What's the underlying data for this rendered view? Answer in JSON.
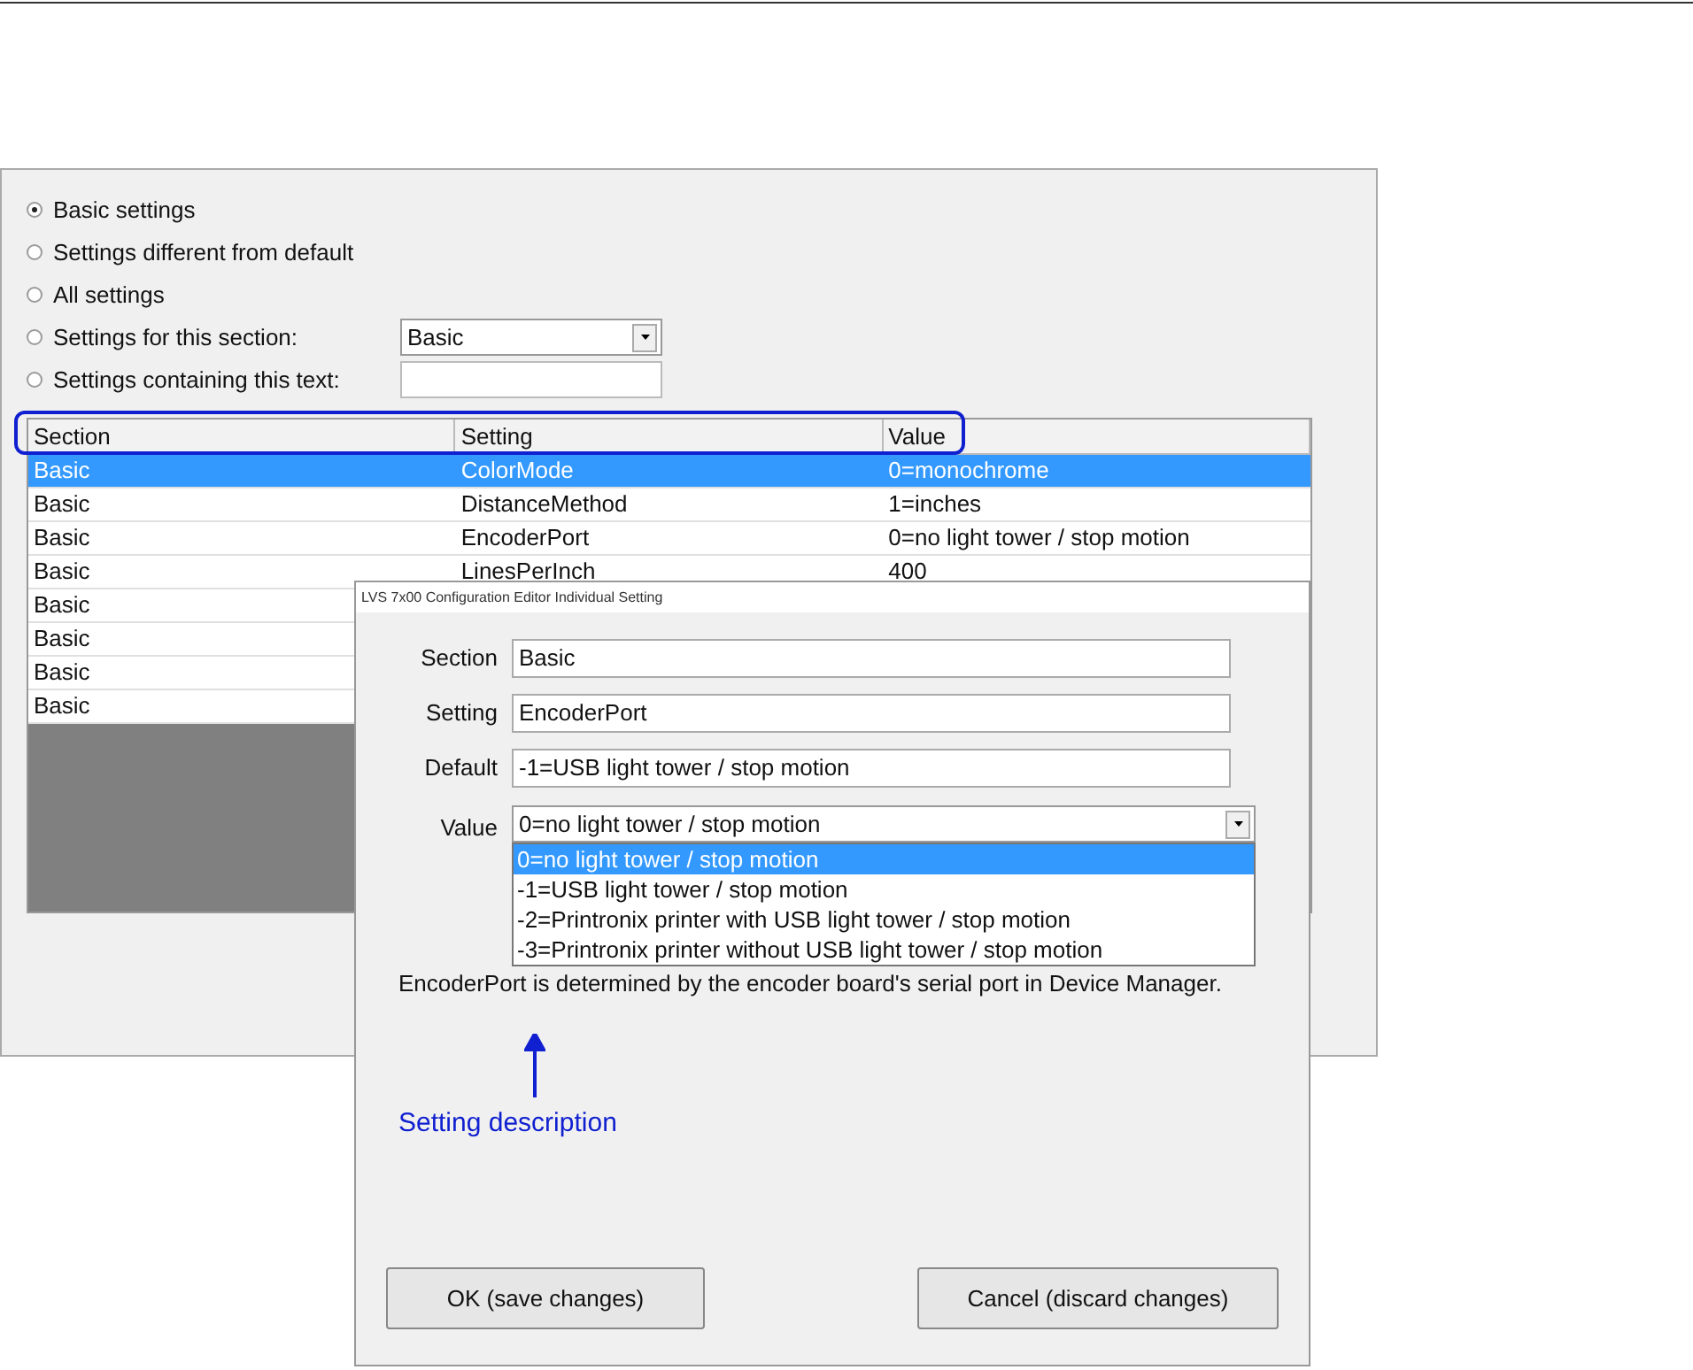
{
  "filter_options": [
    {
      "label": "Basic settings",
      "selected": true
    },
    {
      "label": "Settings different from default",
      "selected": false
    },
    {
      "label": "All settings",
      "selected": false
    },
    {
      "label": "Settings for this section:",
      "selected": false,
      "kind": "dropdown",
      "value": "Basic"
    },
    {
      "label": "Settings containing this text:",
      "selected": false,
      "kind": "text"
    }
  ],
  "table": {
    "columns": [
      "Section",
      "Setting",
      "Value"
    ],
    "rows": [
      {
        "cells": [
          "Basic",
          "ColorMode",
          "0=monochrome"
        ],
        "selected": true
      },
      {
        "cells": [
          "Basic",
          "DistanceMethod",
          "1=inches"
        ],
        "selected": false
      },
      {
        "cells": [
          "Basic",
          "EncoderPort",
          "0=no light tower / stop motion"
        ],
        "selected": false
      },
      {
        "cells": [
          "Basic",
          "LinesPerInch",
          "400"
        ],
        "selected": false
      },
      {
        "cells": [
          "Basic"
        ],
        "selected": false
      },
      {
        "cells": [
          "Basic"
        ],
        "selected": false
      },
      {
        "cells": [
          "Basic"
        ],
        "selected": false
      },
      {
        "cells": [
          "Basic"
        ],
        "selected": false
      }
    ]
  },
  "dialog": {
    "title": "LVS 7x00 Configuration Editor Individual Setting",
    "fields": [
      {
        "label": "Section",
        "value": "Basic"
      },
      {
        "label": "Setting",
        "value": "EncoderPort"
      },
      {
        "label": "Default",
        "value": "-1=USB light tower / stop motion"
      }
    ],
    "value_field": {
      "label": "Value",
      "value": "0=no light tower / stop motion",
      "options": [
        {
          "label": "0=no light tower / stop motion",
          "selected": true
        },
        {
          "label": "-1=USB light tower / stop motion",
          "selected": false
        },
        {
          "label": "-2=Printronix printer with USB light tower / stop motion",
          "selected": false
        },
        {
          "label": "-3=Printronix printer without USB light tower / stop motion",
          "selected": false
        }
      ]
    },
    "description": "EncoderPort is determined by the encoder board's serial port in Device Manager.",
    "buttons": [
      "OK (save changes)",
      "Cancel (discard changes)"
    ]
  },
  "annotation": "Setting description"
}
